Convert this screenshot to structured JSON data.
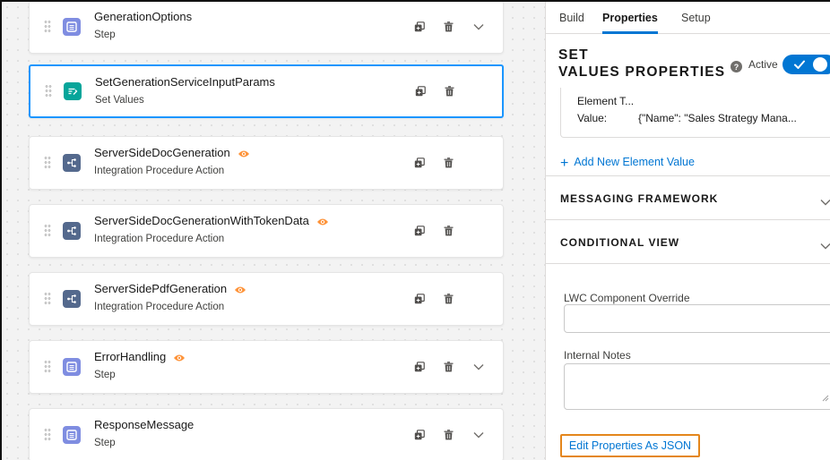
{
  "colors": {
    "accent": "#0176d3",
    "step_icon": "#7f8de1",
    "set_values_icon": "#06a59a",
    "ip_action_icon": "#54698d",
    "eye_icon": "#fe9339",
    "highlight": "#e4861c",
    "selected_border": "#1b96ff"
  },
  "canvas": {
    "cards": [
      {
        "title": "GenerationOptions",
        "subtitle": "Step",
        "icon": "step-icon",
        "has_eye": false,
        "has_chevron": true,
        "selected": false
      },
      {
        "title": "SetGenerationServiceInputParams",
        "subtitle": "Set Values",
        "icon": "set-values-icon",
        "has_eye": false,
        "has_chevron": false,
        "selected": true
      },
      {
        "title": "ServerSideDocGeneration",
        "subtitle": "Integration Procedure Action",
        "icon": "integration-procedure-icon",
        "has_eye": true,
        "has_chevron": false,
        "selected": false
      },
      {
        "title": "ServerSideDocGenerationWithTokenData",
        "subtitle": "Integration Procedure Action",
        "icon": "integration-procedure-icon",
        "has_eye": true,
        "has_chevron": false,
        "selected": false
      },
      {
        "title": "ServerSidePdfGeneration",
        "subtitle": "Integration Procedure Action",
        "icon": "integration-procedure-icon",
        "has_eye": true,
        "has_chevron": false,
        "selected": false
      },
      {
        "title": "ErrorHandling",
        "subtitle": "Step",
        "icon": "step-icon",
        "has_eye": true,
        "has_chevron": true,
        "selected": false
      },
      {
        "title": "ResponseMessage",
        "subtitle": "Step",
        "icon": "step-icon",
        "has_eye": false,
        "has_chevron": true,
        "selected": false
      }
    ]
  },
  "panel": {
    "tabs": [
      {
        "label": "Build",
        "active": false
      },
      {
        "label": "Properties",
        "active": true
      },
      {
        "label": "Setup",
        "active": false
      }
    ],
    "heading_line1": "SET",
    "heading_line2": "VALUES PROPERTIES",
    "active_label": "Active",
    "active_on": true,
    "element_value": {
      "type_label": "Element T...",
      "value_label": "Value:",
      "value": "{\"Name\": \"Sales Strategy Mana..."
    },
    "add_value_label": "Add New Element Value",
    "sections": [
      {
        "title": "MESSAGING FRAMEWORK"
      },
      {
        "title": "CONDITIONAL VIEW"
      }
    ],
    "lwc_override_label": "LWC Component Override",
    "lwc_override_value": "",
    "internal_notes_label": "Internal Notes",
    "internal_notes_value": "",
    "edit_json_label": "Edit Properties As JSON"
  }
}
